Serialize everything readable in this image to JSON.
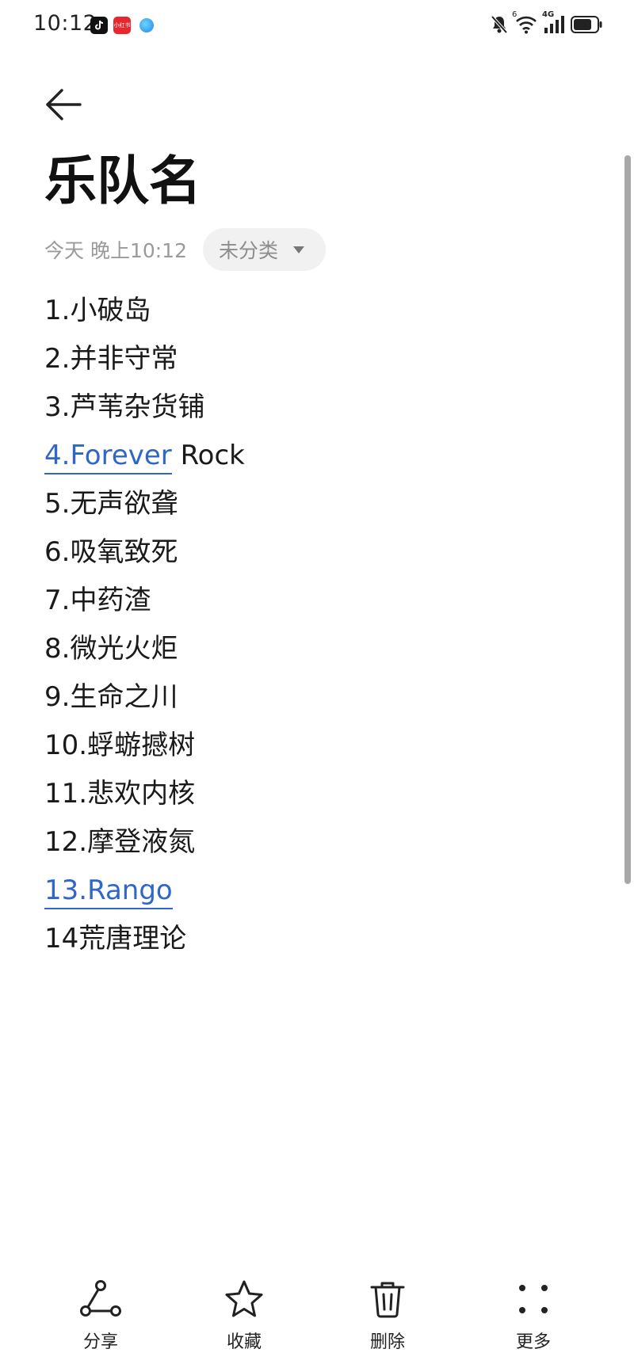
{
  "status_bar": {
    "time": "10:12",
    "app_badge_red_text": "小红书",
    "signal_label": "4G",
    "sim_label": "6"
  },
  "header": {
    "title": "乐队名",
    "date": "今天 晚上10:12",
    "category": "未分类"
  },
  "note": {
    "lines": [
      [
        {
          "text": "1.小破岛"
        }
      ],
      [
        {
          "text": "2.并非守常"
        }
      ],
      [
        {
          "text": "3.芦苇杂货铺"
        }
      ],
      [
        {
          "text": "4.Forever",
          "link": true
        },
        {
          "text": " Rock"
        }
      ],
      [
        {
          "text": "5.无声欲聋"
        }
      ],
      [
        {
          "text": "6.吸氧致死"
        }
      ],
      [
        {
          "text": "7.中药渣"
        }
      ],
      [
        {
          "text": "8.微光火炬"
        }
      ],
      [
        {
          "text": "9.生命之川"
        }
      ],
      [
        {
          "text": "10.蜉蝣撼树"
        }
      ],
      [
        {
          "text": "11.悲欢内核"
        }
      ],
      [
        {
          "text": "12.摩登液氮"
        }
      ],
      [
        {
          "text": "13.Rango",
          "link": true
        }
      ],
      [
        {
          "text": "14荒唐理论"
        }
      ]
    ]
  },
  "toolbar": {
    "share_label": "分享",
    "favorite_label": "收藏",
    "delete_label": "删除",
    "more_label": "更多"
  },
  "colors": {
    "link": "#2f66c9",
    "muted_text": "#9a9a9a",
    "chip_bg": "#f1f1f1"
  },
  "icons": {
    "back": "arrow-left-icon",
    "share": "share-icon",
    "favorite": "star-icon",
    "delete": "trash-icon",
    "more": "dots-grid-icon",
    "dropdown": "triangle-down-icon"
  }
}
